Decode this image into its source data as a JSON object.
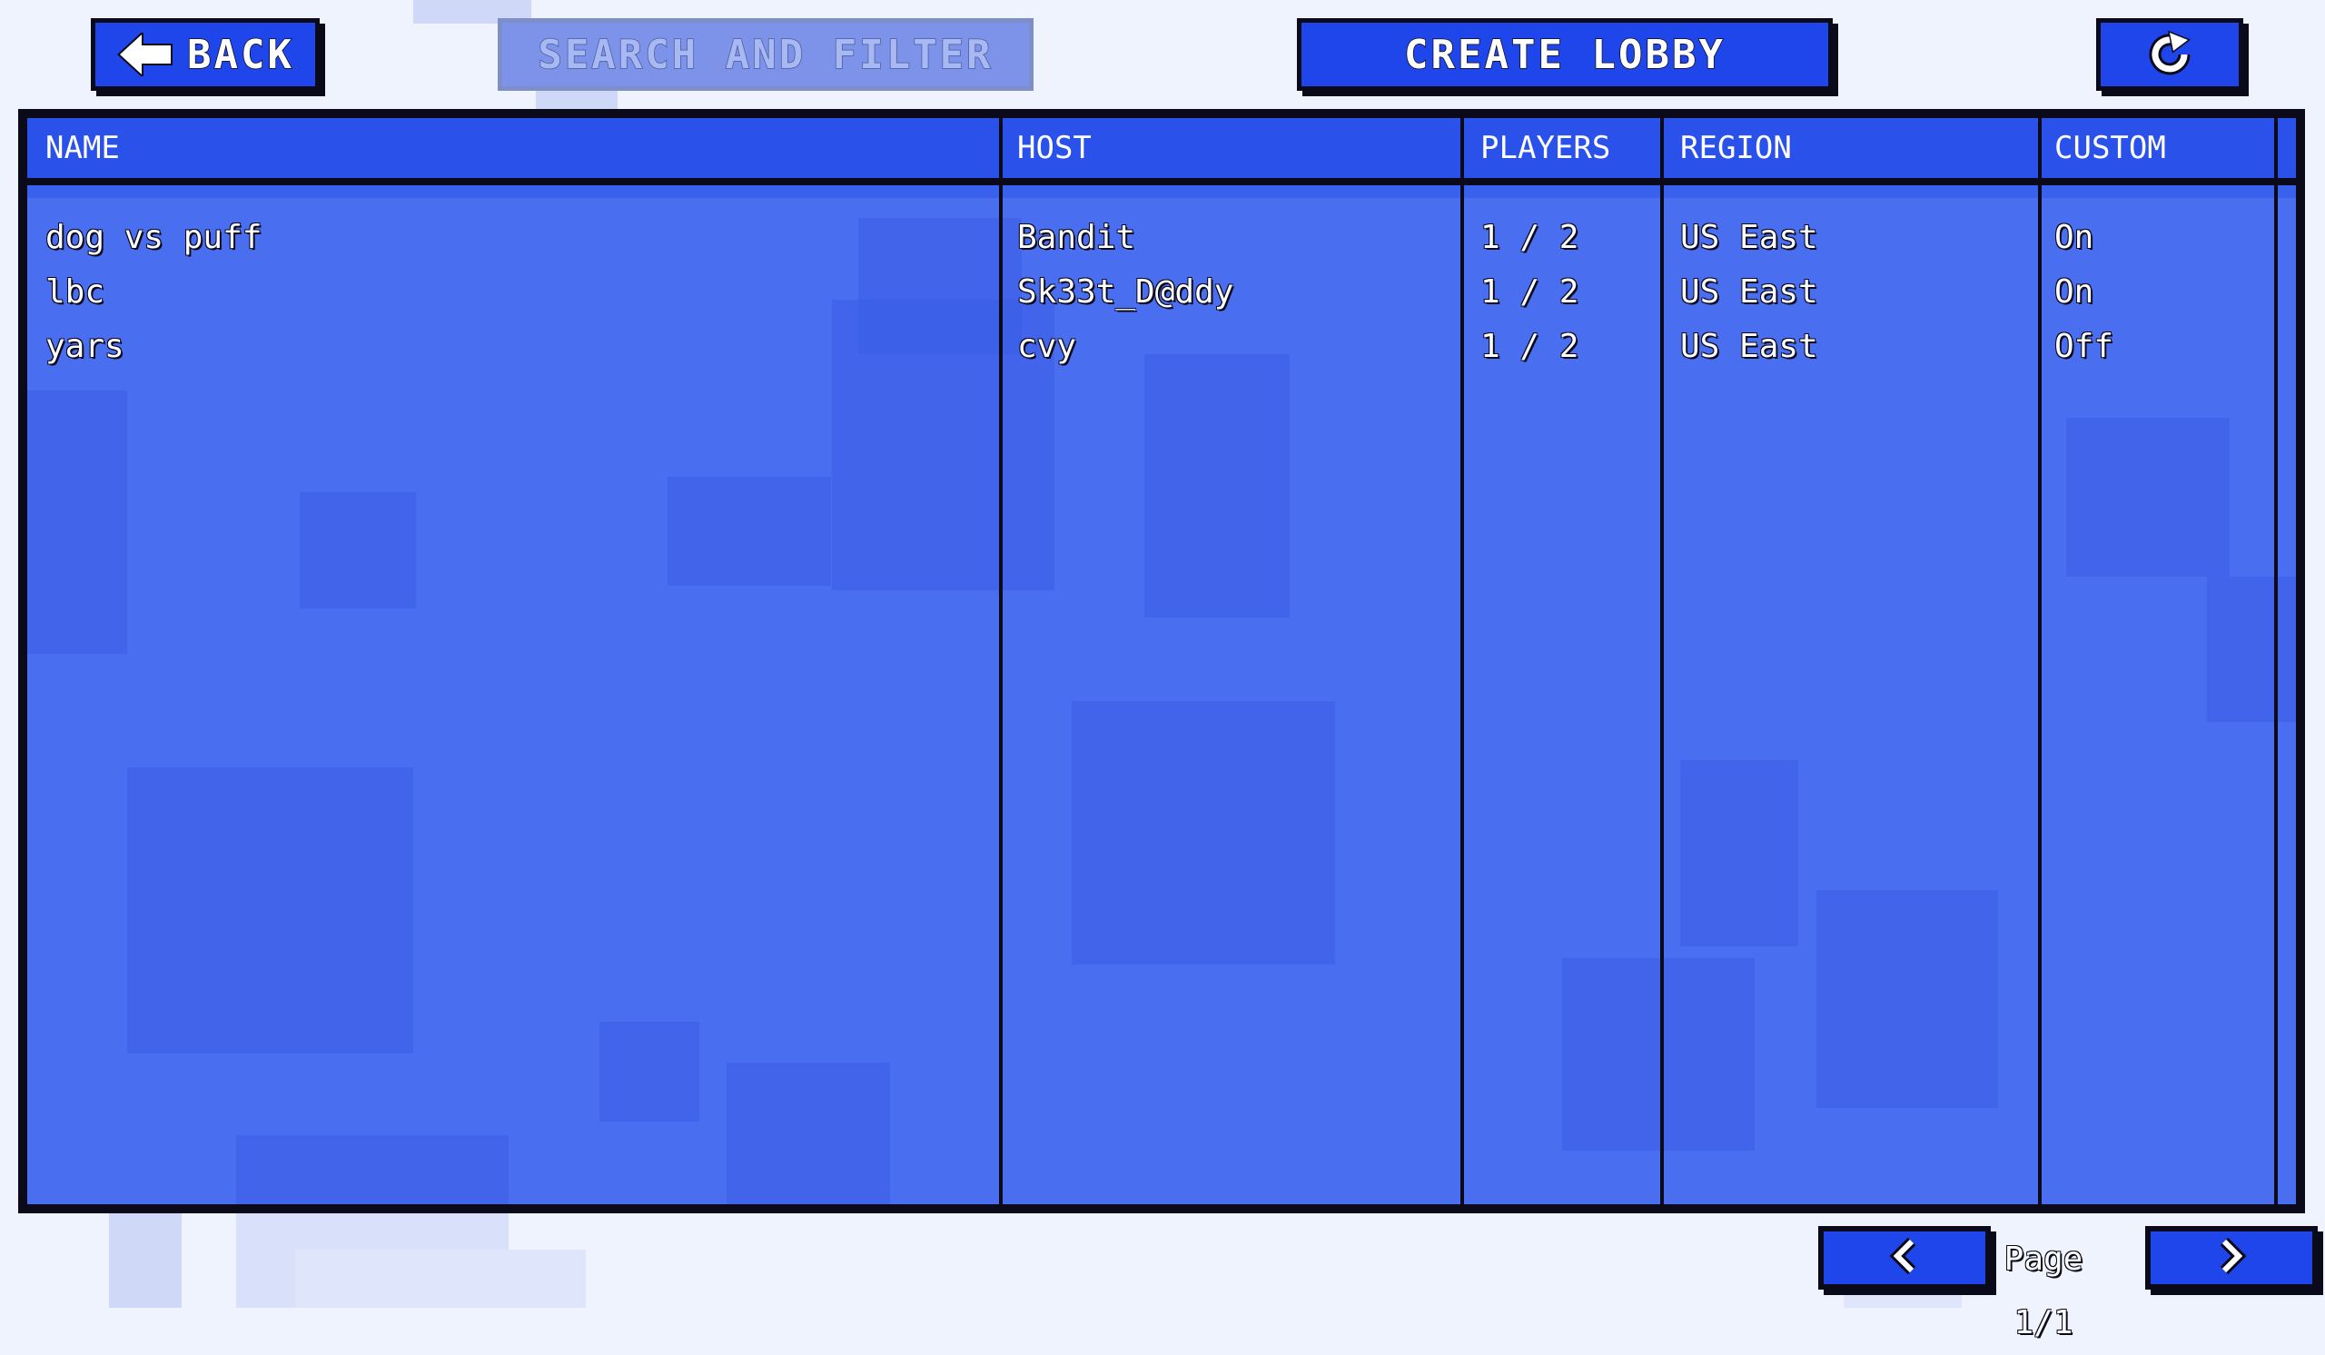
{
  "toolbar": {
    "back_label": "BACK",
    "search_label": "SEARCH AND FILTER",
    "create_label": "CREATE LOBBY"
  },
  "icons": {
    "back": "arrow-left-icon",
    "refresh": "refresh-icon",
    "prev": "chevron-left-icon",
    "next": "chevron-right-icon"
  },
  "table": {
    "columns": [
      "NAME",
      "HOST",
      "PLAYERS",
      "REGION",
      "CUSTOM"
    ],
    "rows": [
      [
        "dog vs puff",
        "Bandit",
        "1 / 2",
        "US East",
        "On"
      ],
      [
        "lbc",
        "Sk33t_D@ddy",
        "1 / 2",
        "US East",
        "On"
      ],
      [
        "yars",
        "cvy",
        "1 / 2",
        "US East",
        "Off"
      ]
    ]
  },
  "pagination": {
    "label": "Page 1/1"
  },
  "colors": {
    "accent": "#1f46ea",
    "panel": "#4a6ef0",
    "header": "#2a52ea",
    "border": "#0a0a1a",
    "background": "#eef3fd"
  }
}
